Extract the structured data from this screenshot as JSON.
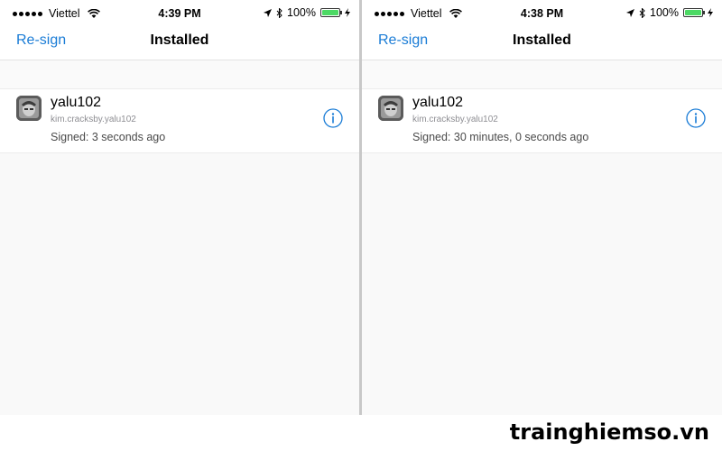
{
  "panels": [
    {
      "status": {
        "carrier": "Viettel",
        "time": "4:39 PM",
        "battery": "100%"
      },
      "nav": {
        "left_button": "Re-sign",
        "title": "Installed"
      },
      "app": {
        "name": "yalu102",
        "bundle_id": "kim.cracksby.yalu102",
        "signed": "Signed: 3 seconds ago"
      }
    },
    {
      "status": {
        "carrier": "Viettel",
        "time": "4:38 PM",
        "battery": "100%"
      },
      "nav": {
        "left_button": "Re-sign",
        "title": "Installed"
      },
      "app": {
        "name": "yalu102",
        "bundle_id": "kim.cracksby.yalu102",
        "signed": "Signed: 30 minutes, 0 seconds ago"
      }
    }
  ],
  "watermark": "trainghiemso.vn",
  "colors": {
    "accent": "#1a7cd6",
    "battery": "#4cd964"
  },
  "icons": [
    "signal-dots-icon",
    "wifi-icon",
    "location-arrow-icon",
    "bluetooth-icon",
    "battery-icon",
    "charging-bolt-icon",
    "info-icon",
    "app-icon"
  ]
}
